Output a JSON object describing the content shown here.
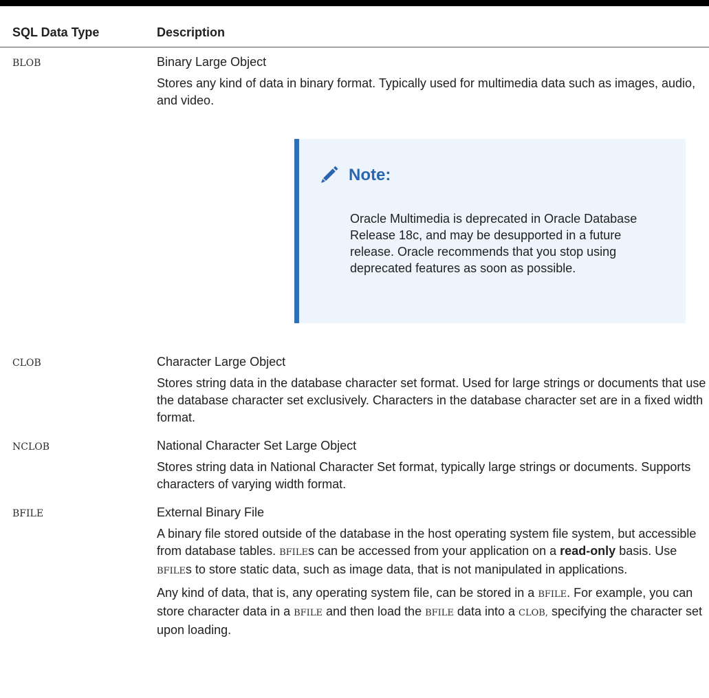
{
  "table": {
    "headers": {
      "type": "SQL Data Type",
      "description": "Description"
    },
    "rows": [
      {
        "type": "BLOB",
        "name": "Binary Large Object",
        "text": "Stores any kind of data in binary format. Typically used for multimedia data such as images, audio, and video."
      },
      {
        "type": "CLOB",
        "name": "Character Large Object",
        "text": "Stores string data in the database character set format. Used for large strings or documents that use the database character set exclusively. Characters in the database character set are in a fixed width format."
      },
      {
        "type": "NCLOB",
        "name": "National Character Set Large Object",
        "text": "Stores string data in National Character Set format, typically large strings or documents. Supports characters of varying width format."
      },
      {
        "type": "BFILE",
        "name": "External Binary File",
        "p1": {
          "a": "A binary file stored outside of the database in the host operating system file system, but accessible from database tables. ",
          "code1": "BFILE",
          "b": "s can be accessed from your application on a ",
          "bold": "read-only",
          "c": " basis. Use ",
          "code2": "BFILE",
          "d": "s to store static data, such as image data, that is not manipulated in applications."
        },
        "p2": {
          "a": "Any kind of data, that is, any operating system file, can be stored in a ",
          "code1": "BFILE",
          "b": ". For example, you can store character data in a ",
          "code2": "BFILE",
          "c": " and then load the ",
          "code3": "BFILE",
          "d": " data into a ",
          "code4": "CLOB,",
          "e": " specifying the character set upon loading."
        }
      }
    ]
  },
  "note": {
    "icon": "pencil-icon",
    "title": "Note:",
    "body": "Oracle Multimedia is deprecated in Oracle Database Release 18c, and may be desupported in a future release. Oracle recommends that you stop using deprecated features as soon as possible."
  },
  "colors": {
    "note_accent": "#2f6fb5",
    "note_background": "#eef4fb",
    "note_title": "#2a66b0"
  }
}
